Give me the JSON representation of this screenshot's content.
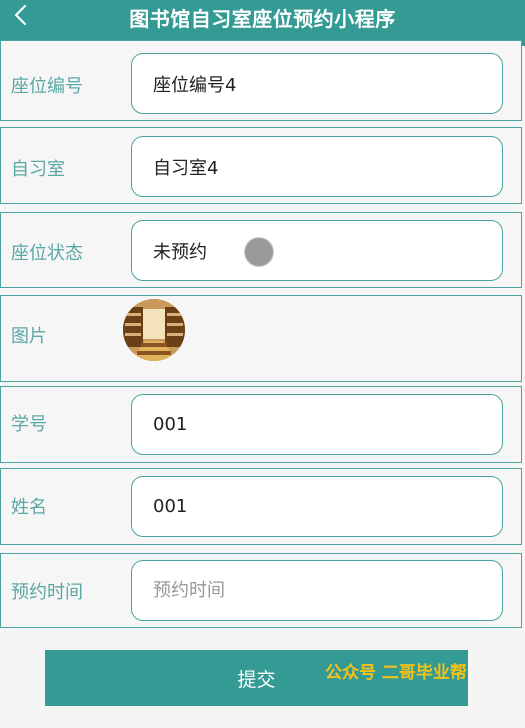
{
  "header": {
    "title": "图书馆自习室座位预约小程序",
    "back_icon": "chevron-left-icon"
  },
  "form": {
    "seat_number": {
      "label": "座位编号",
      "value": "座位编号4"
    },
    "study_room": {
      "label": "自习室",
      "value": "自习室4"
    },
    "seat_status": {
      "label": "座位状态",
      "value": "未预约"
    },
    "image": {
      "label": "图片"
    },
    "student_id": {
      "label": "学号",
      "value": "001"
    },
    "name": {
      "label": "姓名",
      "value": "001"
    },
    "reservation_time": {
      "label": "预约时间",
      "placeholder": "预约时间"
    }
  },
  "submit_label": "提交",
  "watermark": "公众号 二哥毕业帮",
  "colors": {
    "accent": "#339a94",
    "label": "#5aa8a3",
    "watermark": "#f2c21a"
  }
}
